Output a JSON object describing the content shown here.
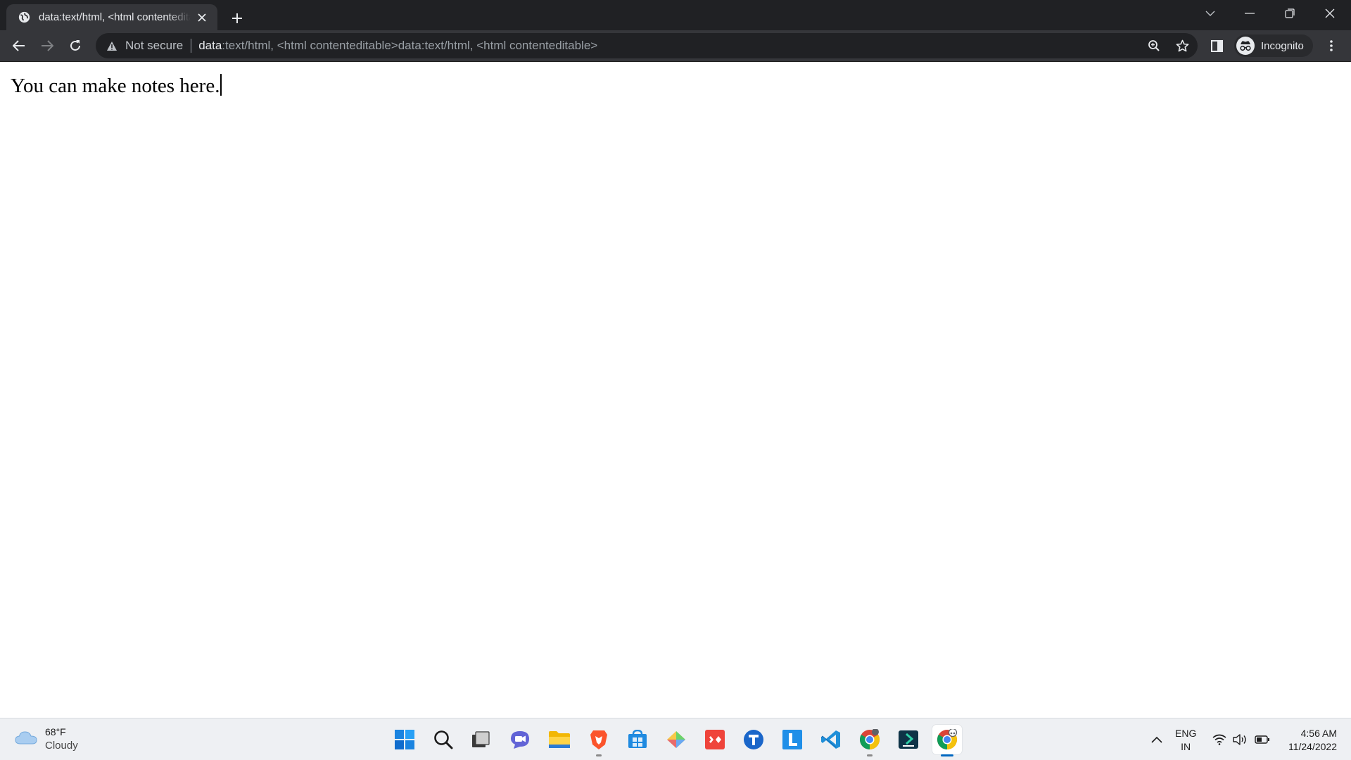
{
  "browser": {
    "tab": {
      "title": "data:text/html, <html contenteditable>"
    },
    "omnibox": {
      "security_label": "Not secure",
      "url_scheme": "data",
      "url_rest": ":text/html, <html contenteditable>data:text/html, <html contenteditable>"
    },
    "profile": {
      "label": "Incognito"
    }
  },
  "page": {
    "note_text": "You can make notes here."
  },
  "taskbar": {
    "weather": {
      "temp": "68°F",
      "condition": "Cloudy"
    },
    "lang": {
      "line1": "ENG",
      "line2": "IN"
    },
    "clock": {
      "time": "4:56 AM",
      "date": "11/24/2022"
    }
  },
  "colors": {
    "chrome_dark": "#202124",
    "chrome_toolbar": "#35363a",
    "taskbar_bg": "#eef0f3",
    "accent": "#0067c0"
  },
  "icons": {
    "tab": [
      "globe-icon",
      "close-icon",
      "plus-icon"
    ],
    "window": [
      "chevron-down-icon",
      "minimize-icon",
      "restore-icon",
      "close-icon"
    ],
    "toolbar": [
      "back-arrow-icon",
      "forward-arrow-icon",
      "reload-icon",
      "warning-icon",
      "zoom-icon",
      "star-icon",
      "side-panel-icon",
      "incognito-icon",
      "more-vert-icon"
    ],
    "taskbar_apps": [
      "windows-start-icon",
      "search-icon",
      "task-view-icon",
      "teams-chat-icon",
      "file-explorer-icon",
      "brave-icon",
      "store-icon",
      "gem-icon",
      "anydesk-icon",
      "t-app-icon",
      "l-app-icon",
      "vscode-icon",
      "chrome-icon",
      "terminal-app-icon",
      "chrome-incognito-icon"
    ],
    "tray": [
      "chevron-up-icon",
      "wifi-icon",
      "volume-icon",
      "battery-icon"
    ]
  }
}
